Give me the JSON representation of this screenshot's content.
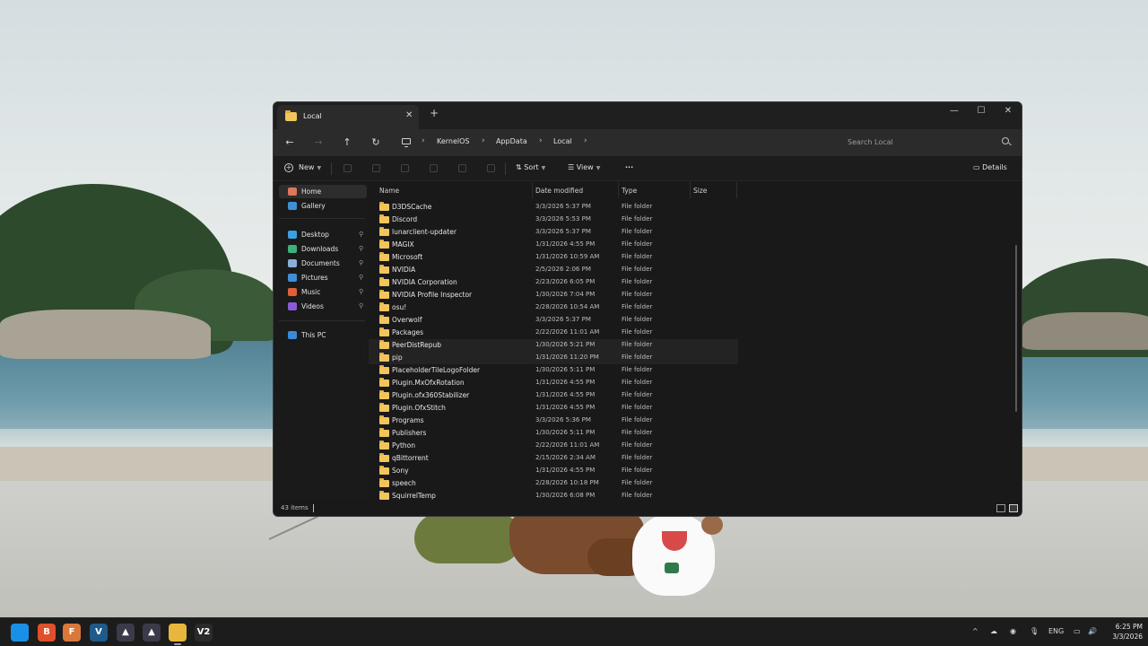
{
  "window": {
    "tab_title": "Local",
    "tab_close": "✕",
    "new_tab": "+",
    "controls": {
      "minimize": "—",
      "maximize": "☐",
      "close": "✕"
    }
  },
  "nav": {
    "back": "←",
    "forward": "→",
    "up": "↑",
    "refresh": "↻",
    "breadcrumbs": [
      "KernelOS",
      "AppData",
      "Local"
    ],
    "separator": "›",
    "search_placeholder": "Search Local"
  },
  "toolbar": {
    "new_label": "New",
    "sort_label": "Sort",
    "view_label": "View",
    "more_label": "···",
    "details_label": "Details"
  },
  "sidebar": {
    "items": [
      {
        "label": "Home",
        "icon": "home-icon",
        "color": "#d9785a",
        "pinned": false
      },
      {
        "label": "Gallery",
        "icon": "gallery-icon",
        "color": "#3f8fd6",
        "pinned": false
      },
      {
        "label": "Desktop",
        "icon": "desktop-icon",
        "color": "#3aa0e0",
        "pinned": true
      },
      {
        "label": "Downloads",
        "icon": "download-icon",
        "color": "#3fb07a",
        "pinned": true
      },
      {
        "label": "Documents",
        "icon": "document-icon",
        "color": "#8ab0d8",
        "pinned": true
      },
      {
        "label": "Pictures",
        "icon": "picture-icon",
        "color": "#3f8fd6",
        "pinned": true
      },
      {
        "label": "Music",
        "icon": "music-icon",
        "color": "#e0603a",
        "pinned": true
      },
      {
        "label": "Videos",
        "icon": "video-icon",
        "color": "#8a5ad8",
        "pinned": true
      },
      {
        "label": "This PC",
        "icon": "pc-icon",
        "color": "#3a8ad8",
        "pinned": false
      }
    ]
  },
  "columns": {
    "name": "Name",
    "date": "Date modified",
    "type": "Type",
    "size": "Size"
  },
  "files": [
    {
      "name": "D3DSCache",
      "date": "3/3/2026 5:37 PM",
      "type": "File folder"
    },
    {
      "name": "Discord",
      "date": "3/3/2026 5:53 PM",
      "type": "File folder"
    },
    {
      "name": "lunarclient-updater",
      "date": "3/3/2026 5:37 PM",
      "type": "File folder"
    },
    {
      "name": "MAGIX",
      "date": "1/31/2026 4:55 PM",
      "type": "File folder"
    },
    {
      "name": "Microsoft",
      "date": "1/31/2026 10:59 AM",
      "type": "File folder"
    },
    {
      "name": "NVIDIA",
      "date": "2/5/2026 2:06 PM",
      "type": "File folder"
    },
    {
      "name": "NVIDIA Corporation",
      "date": "2/23/2026 6:05 PM",
      "type": "File folder"
    },
    {
      "name": "NVIDIA Profile Inspector",
      "date": "1/30/2026 7:04 PM",
      "type": "File folder"
    },
    {
      "name": "osu!",
      "date": "2/28/2026 10:54 AM",
      "type": "File folder"
    },
    {
      "name": "Overwolf",
      "date": "3/3/2026 5:37 PM",
      "type": "File folder"
    },
    {
      "name": "Packages",
      "date": "2/22/2026 11:01 AM",
      "type": "File folder"
    },
    {
      "name": "PeerDistRepub",
      "date": "1/30/2026 5:21 PM",
      "type": "File folder"
    },
    {
      "name": "pip",
      "date": "1/31/2026 11:20 PM",
      "type": "File folder"
    },
    {
      "name": "PlaceholderTileLogoFolder",
      "date": "1/30/2026 5:11 PM",
      "type": "File folder"
    },
    {
      "name": "Plugin.MxOfxRotation",
      "date": "1/31/2026 4:55 PM",
      "type": "File folder"
    },
    {
      "name": "Plugin.ofx360Stabilizer",
      "date": "1/31/2026 4:55 PM",
      "type": "File folder"
    },
    {
      "name": "Plugin.OfxStitch",
      "date": "1/31/2026 4:55 PM",
      "type": "File folder"
    },
    {
      "name": "Programs",
      "date": "3/3/2026 5:36 PM",
      "type": "File folder"
    },
    {
      "name": "Publishers",
      "date": "1/30/2026 5:11 PM",
      "type": "File folder"
    },
    {
      "name": "Python",
      "date": "2/22/2026 11:01 AM",
      "type": "File folder"
    },
    {
      "name": "qBittorrent",
      "date": "2/15/2026 2:34 AM",
      "type": "File folder"
    },
    {
      "name": "Sony",
      "date": "1/31/2026 4:55 PM",
      "type": "File folder"
    },
    {
      "name": "speech",
      "date": "2/28/2026 10:18 PM",
      "type": "File folder"
    },
    {
      "name": "SquirrelTemp",
      "date": "1/30/2026 6:08 PM",
      "type": "File folder"
    }
  ],
  "status": {
    "item_count": "43 items"
  },
  "taskbar": {
    "apps": [
      {
        "name": "start-button",
        "glyph": "",
        "color": "#1a8fe8"
      },
      {
        "name": "brave-app",
        "glyph": "B",
        "color": "#e0502a"
      },
      {
        "name": "firefox-dev-app",
        "glyph": "F",
        "color": "#d8783a"
      },
      {
        "name": "vegas-app",
        "glyph": "V",
        "color": "#1e5a8a"
      },
      {
        "name": "lunar-app",
        "glyph": "▲",
        "color": "#3a3a4a"
      },
      {
        "name": "lunar-app-2",
        "glyph": "▲",
        "color": "#3a3a4a"
      },
      {
        "name": "file-explorer-app",
        "glyph": "",
        "color": "#e8b63e"
      },
      {
        "name": "v2-app",
        "glyph": "V2",
        "color": "#2a2a2a"
      }
    ],
    "tray": {
      "chevron": "^",
      "language": "ENG"
    },
    "clock": {
      "time": "6:25 PM",
      "date": "3/3/2026"
    }
  }
}
